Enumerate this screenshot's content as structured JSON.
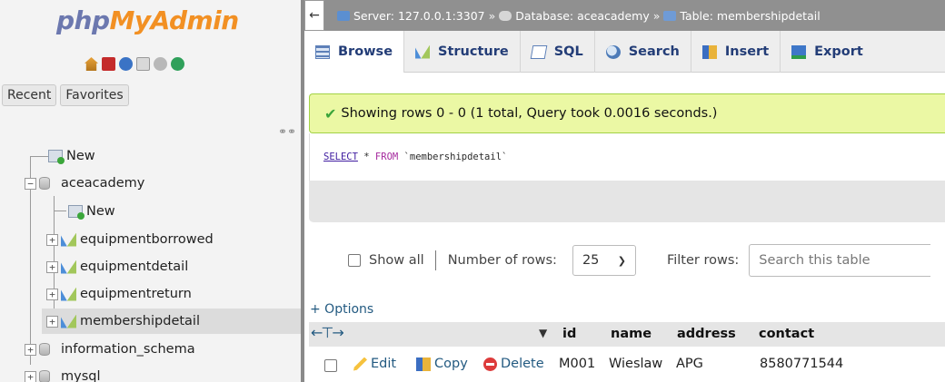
{
  "nav": {
    "logo_part1": "php",
    "logo_part2": "MyAdmin",
    "tab_recent": "Recent",
    "tab_favorites": "Favorites",
    "tree": {
      "new_root": "New",
      "db_aceacademy": "aceacademy",
      "new_table": "New",
      "tables": [
        "equipmentborrowed",
        "equipmentdetail",
        "equipmentreturn",
        "membershipdetail"
      ],
      "db_information_schema": "information_schema",
      "db_mysql": "mysql"
    }
  },
  "topbar": {
    "back_arrow": "←",
    "server": "Server: 127.0.0.1:3307",
    "sep": "»",
    "database": "Database: aceacademy",
    "table": "Table: membershipdetail"
  },
  "tabs": {
    "browse": "Browse",
    "structure": "Structure",
    "sql": "SQL",
    "search": "Search",
    "insert": "Insert",
    "export": "Export"
  },
  "message": "Showing rows 0 - 0 (1 total, Query took 0.0016 seconds.)",
  "query": {
    "select_kw": "SELECT",
    "star": "*",
    "from_kw": "FROM",
    "table": "`membershipdetail`"
  },
  "controls": {
    "show_all": "Show all",
    "number_of_rows_label": "Number of rows:",
    "rows_value": "25",
    "filter_label": "Filter rows:",
    "search_placeholder": "Search this table"
  },
  "options_link": "+ Options",
  "table": {
    "columns": [
      "id",
      "name",
      "address",
      "contact"
    ],
    "actions": {
      "edit": "Edit",
      "copy": "Copy",
      "delete": "Delete"
    },
    "rows": [
      {
        "id": "M001",
        "name": "Wieslaw",
        "address": "APG",
        "contact": "8580771544"
      }
    ]
  },
  "colors": {
    "accent": "#235a81",
    "logo_php": "#6c78af",
    "logo_myadmin": "#f29023",
    "success_bg": "#ebf8a4"
  }
}
